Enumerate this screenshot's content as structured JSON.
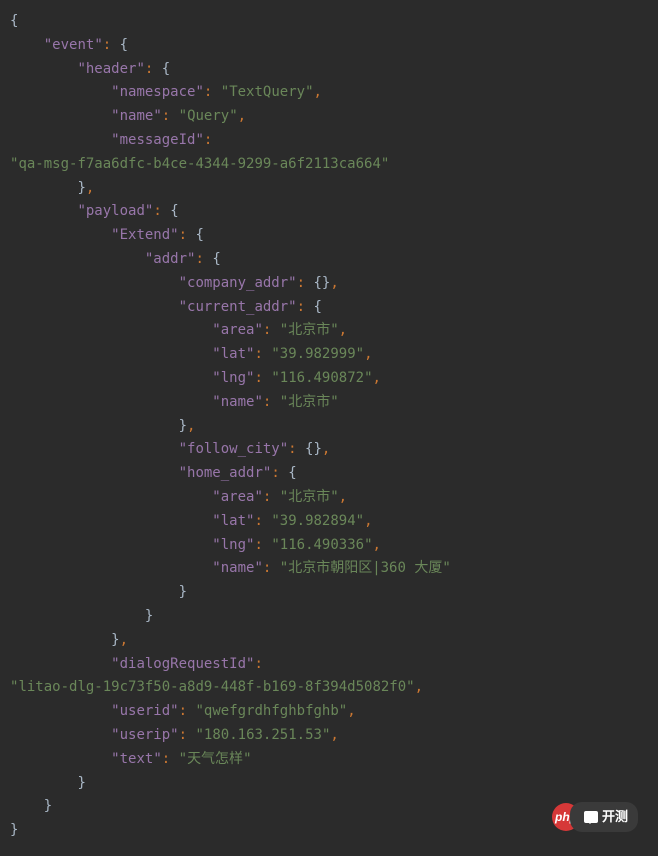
{
  "code": {
    "event": {
      "header": {
        "namespace": "TextQuery",
        "name": "Query",
        "messageId": "qa-msg-f7aa6dfc-b4ce-4344-9299-a6f2113ca664"
      },
      "payload": {
        "Extend": {
          "addr": {
            "company_addr": {},
            "current_addr": {
              "area": "北京市",
              "lat": "39.982999",
              "lng": "116.490872",
              "name": "北京市"
            },
            "follow_city": {},
            "home_addr": {
              "area": "北京市",
              "lat": "39.982894",
              "lng": "116.490336",
              "name": "北京市朝阳区|360 大厦"
            }
          }
        },
        "dialogRequestId": "litao-dlg-19c73f50-a8d9-448f-b169-8f394d5082f0",
        "userid": "qwefgrdhfghbfghb",
        "userip": "180.163.251.53",
        "text": "天气怎样"
      }
    }
  },
  "keys": {
    "event": "event",
    "header": "header",
    "namespace": "namespace",
    "name": "name",
    "messageId": "messageId",
    "payload": "payload",
    "Extend": "Extend",
    "addr": "addr",
    "company_addr": "company_addr",
    "current_addr": "current_addr",
    "area": "area",
    "lat": "lat",
    "lng": "lng",
    "follow_city": "follow_city",
    "home_addr": "home_addr",
    "dialogRequestId": "dialogRequestId",
    "userid": "userid",
    "userip": "userip",
    "text": "text"
  },
  "badge": {
    "logo": "php",
    "label": "开测"
  }
}
